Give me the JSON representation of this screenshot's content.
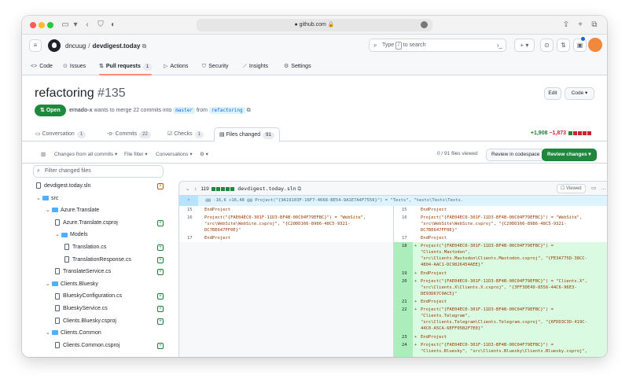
{
  "browser": {
    "url": "github.com",
    "colors": {
      "close": "#ff5f57",
      "minimize": "#febc2e",
      "zoom": "#28c840"
    }
  },
  "header": {
    "owner": "dncuug",
    "repo": "devdigest.today",
    "search_prefix": "Type",
    "search_key": "/",
    "search_suffix": "to search",
    "plus_label": "+ ▾"
  },
  "repo_nav": [
    {
      "label": "Code",
      "icon": "code-icon"
    },
    {
      "label": "Issues",
      "icon": "issue-icon"
    },
    {
      "label": "Pull requests",
      "icon": "pull-request-icon",
      "count": "1"
    },
    {
      "label": "Actions",
      "icon": "play-icon"
    },
    {
      "label": "Security",
      "icon": "shield-icon"
    },
    {
      "label": "Insights",
      "icon": "graph-icon"
    },
    {
      "label": "Settings",
      "icon": "gear-icon"
    }
  ],
  "pr": {
    "title": "refactoring",
    "number": "#135",
    "state": "Open",
    "author": "ernado-x",
    "meta_text": "wants to merge 22 commits into",
    "base_branch": "master",
    "from_text": "from",
    "head_branch": "refactoring",
    "edit_label": "Edit",
    "code_label": "Code ▾"
  },
  "tabs": [
    {
      "label": "Conversation",
      "count": "1"
    },
    {
      "label": "Commits",
      "count": "22"
    },
    {
      "label": "Checks",
      "count": "1"
    },
    {
      "label": "Files changed",
      "count": "91"
    }
  ],
  "diffstat": {
    "additions": "+1,908",
    "deletions": "−1,873"
  },
  "toolbar": {
    "changes_from": "Changes from all commits ▾",
    "file_filter": "File filter ▾",
    "conversations": "Conversations ▾",
    "settings": "⚙ ▾",
    "files_viewed": "0 / 91 files viewed",
    "review_codespace": "Review in codespace",
    "review_changes": "Review changes ▾"
  },
  "tree": {
    "filter_placeholder": "Filter changed files",
    "items": [
      {
        "label": "devdigest.today.sln",
        "type": "file",
        "status": "modified",
        "depth": 0
      },
      {
        "label": "src",
        "type": "folder",
        "depth": 0
      },
      {
        "label": "Azure.Translate",
        "type": "folder",
        "depth": 1
      },
      {
        "label": "Azure.Translate.csproj",
        "type": "file",
        "status": "added",
        "depth": 2
      },
      {
        "label": "Models",
        "type": "folder",
        "depth": 2
      },
      {
        "label": "Translation.cs",
        "type": "file",
        "status": "added",
        "depth": 3
      },
      {
        "label": "TranslationResponse.cs",
        "type": "file",
        "status": "added",
        "depth": 3
      },
      {
        "label": "TranslateService.cs",
        "type": "file",
        "status": "added",
        "depth": 2
      },
      {
        "label": "Clients.Bluesky",
        "type": "folder",
        "depth": 1
      },
      {
        "label": "BlueskyConfiguration.cs",
        "type": "file",
        "status": "added",
        "depth": 2
      },
      {
        "label": "BlueskyService.cs",
        "type": "file",
        "status": "added",
        "depth": 2
      },
      {
        "label": "Clients.Bluesky.csproj",
        "type": "file",
        "status": "added",
        "depth": 2
      },
      {
        "label": "Clients.Common",
        "type": "folder",
        "depth": 1
      },
      {
        "label": "Clients.Common.csproj",
        "type": "file",
        "status": "added",
        "depth": 2
      }
    ]
  },
  "diff": {
    "file_changes": "119",
    "file_name": "devdigest.today.sln",
    "viewed_label": "Viewed",
    "hunk_header": "@@ -16,6 +16,48 @@ Project(\"{9A19103F-16F7-4668-BE54-9A1E7A4F7556}\") = \"Tests\", \"tests\\Tests\\Tests.",
    "rows": [
      {
        "l_ln": "15",
        "l_code": "EndProject",
        "r_ln": "15",
        "r_code": "EndProject",
        "kind": "ctx",
        "h": 8
      },
      {
        "l_ln": "16",
        "l_code": "Project(\"{FAE04EC0-301F-11D3-BF4B-00C04F79EFBC}\") = \"WebSite\",\n\"src\\WebSite\\WebSite.csproj\", \"{C20DD166-8986-48C5-9321-\nDC7BE647FF0E}\"",
        "r_ln": "16",
        "r_code": "Project(\"{FAE04EC0-301F-11D3-BF4B-00C04F79EFBC}\") = \"WebSite\",\n\"src\\WebSite\\WebSite.csproj\", \"{C20DD166-8986-48C5-9321-\nDC7BE647FF0E}\"",
        "kind": "ctx",
        "h": 24
      },
      {
        "l_ln": "17",
        "l_code": "EndProject",
        "r_ln": "17",
        "r_code": "EndProject",
        "kind": "ctx",
        "h": 8
      },
      {
        "l_ln": "",
        "l_code": "",
        "r_ln": "18",
        "r_code": "Project(\"{FAE04EC0-301F-11D3-BF4B-00C04F79EFBC}\") =\n\"Clients.Mastodon\",\n\"src\\Clients.Mastodon\\Clients.Mastodon.csproj\", \"{FE3A775D-38CC-\n4804-AAC1-DC9826454AEE}\"",
        "kind": "add",
        "h": 33
      },
      {
        "l_ln": "",
        "l_code": "",
        "r_ln": "19",
        "r_code": "EndProject",
        "kind": "add",
        "h": 8
      },
      {
        "l_ln": "",
        "l_code": "",
        "r_ln": "20",
        "r_code": "Project(\"{FAE04EC0-301F-11D3-BF4B-00C04F79EFBC}\") = \"Clients.X\",\n\"src\\Clients.X\\Clients.X.csproj\", \"{3FF3DE49-8556-44C6-96E3-\nDE93D67C0AC5}\"",
        "kind": "add",
        "h": 24
      },
      {
        "l_ln": "",
        "l_code": "",
        "r_ln": "21",
        "r_code": "EndProject",
        "kind": "add",
        "h": 8
      },
      {
        "l_ln": "",
        "l_code": "",
        "r_ln": "22",
        "r_code": "Project(\"{FAE04EC0-301F-11D3-BF4B-00C04F79EFBC}\") =\n\"Clients.Telegram\",\n\"src\\Clients.Telegram\\Clients.Telegram.csproj\", \"{6FDD3C3D-419C-\n44C0-A5CA-6EFF05B2F7E0}\"",
        "kind": "add",
        "h": 33
      },
      {
        "l_ln": "",
        "l_code": "",
        "r_ln": "23",
        "r_code": "EndProject",
        "kind": "add",
        "h": 8
      },
      {
        "l_ln": "",
        "l_code": "",
        "r_ln": "24",
        "r_code": "Project(\"{FAE04EC0-301F-11D3-BF4B-00C04F79EFBC}\") =\n\"Clients.Bluesky\", \"src\\Clients.Bluesky\\Clients.Bluesky.csproj\",",
        "kind": "add",
        "h": 20
      }
    ]
  }
}
